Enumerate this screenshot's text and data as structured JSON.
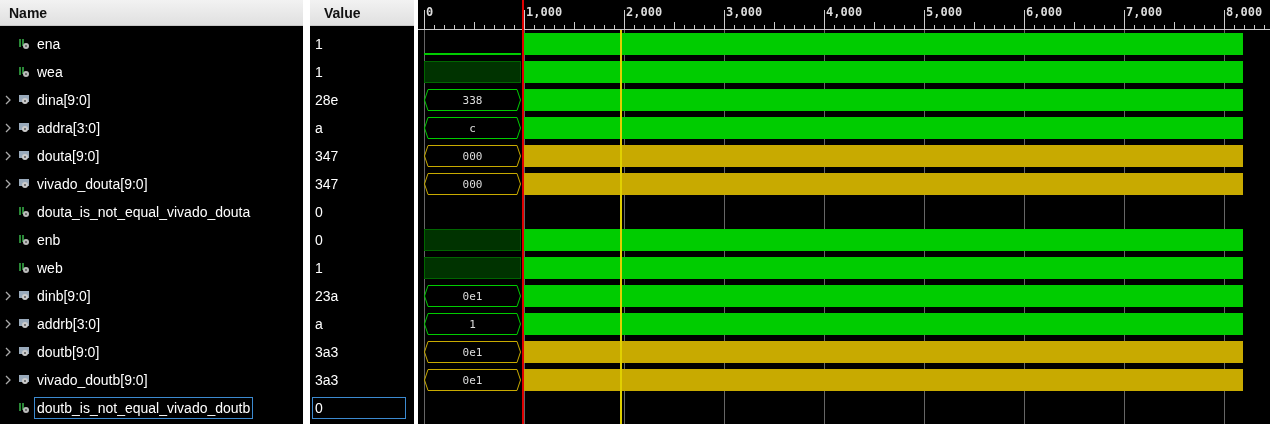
{
  "name_header": "Name",
  "value_header": "Value",
  "ruler": [
    "0",
    "1,000",
    "2,000",
    "3,000",
    "4,000",
    "5,000",
    "6,000",
    "7,000",
    "8,000"
  ],
  "signals": [
    {
      "name": "ena",
      "value": "1",
      "kind": "bit",
      "selected": false,
      "color": "#00cc00",
      "wave": [
        {
          "kind": "low"
        },
        {
          "kind": "fill"
        }
      ]
    },
    {
      "name": "wea",
      "value": "1",
      "kind": "bit",
      "selected": false,
      "color": "#00cc00",
      "wave": [
        {
          "kind": "dim"
        },
        {
          "kind": "fill"
        }
      ]
    },
    {
      "name": "dina[9:0]",
      "value": "28e",
      "kind": "bus",
      "selected": false,
      "color": "#00cc00",
      "wave": [
        {
          "kind": "bus",
          "text": "338"
        },
        {
          "kind": "fill"
        }
      ]
    },
    {
      "name": "addra[3:0]",
      "value": "a",
      "kind": "bus",
      "selected": false,
      "color": "#00cc00",
      "wave": [
        {
          "kind": "bus",
          "text": "c"
        },
        {
          "kind": "fill"
        }
      ]
    },
    {
      "name": "douta[9:0]",
      "value": "347",
      "kind": "bus",
      "selected": false,
      "color": "#c8aa00",
      "wave": [
        {
          "kind": "bus",
          "text": "000"
        },
        {
          "kind": "fill"
        }
      ]
    },
    {
      "name": "vivado_douta[9:0]",
      "value": "347",
      "kind": "bus",
      "selected": false,
      "color": "#c8aa00",
      "wave": [
        {
          "kind": "bus",
          "text": "000"
        },
        {
          "kind": "fill"
        }
      ]
    },
    {
      "name": "douta_is_not_equal_vivado_douta",
      "value": "0",
      "kind": "bit",
      "selected": false
    },
    {
      "name": "enb",
      "value": "0",
      "kind": "bit",
      "selected": false,
      "color": "#00cc00",
      "wave": [
        {
          "kind": "dim"
        },
        {
          "kind": "fill"
        }
      ]
    },
    {
      "name": "web",
      "value": "1",
      "kind": "bit",
      "selected": false,
      "color": "#00cc00",
      "wave": [
        {
          "kind": "dim"
        },
        {
          "kind": "fill"
        }
      ]
    },
    {
      "name": "dinb[9:0]",
      "value": "23a",
      "kind": "bus",
      "selected": false,
      "color": "#00cc00",
      "wave": [
        {
          "kind": "bus",
          "text": "0e1"
        },
        {
          "kind": "fill"
        }
      ]
    },
    {
      "name": "addrb[3:0]",
      "value": "a",
      "kind": "bus",
      "selected": false,
      "color": "#00cc00",
      "wave": [
        {
          "kind": "bus",
          "text": "1"
        },
        {
          "kind": "fill"
        }
      ]
    },
    {
      "name": "doutb[9:0]",
      "value": "3a3",
      "kind": "bus",
      "selected": false,
      "color": "#c8aa00",
      "wave": [
        {
          "kind": "bus",
          "text": "0e1"
        },
        {
          "kind": "fill"
        }
      ]
    },
    {
      "name": "vivado_doutb[9:0]",
      "value": "3a3",
      "kind": "bus",
      "selected": false,
      "color": "#c8aa00",
      "wave": [
        {
          "kind": "bus",
          "text": "0e1"
        },
        {
          "kind": "fill"
        }
      ]
    },
    {
      "name": "doutb_is_not_equal_vivado_doutb",
      "value": "0",
      "kind": "bit",
      "selected": true
    }
  ]
}
